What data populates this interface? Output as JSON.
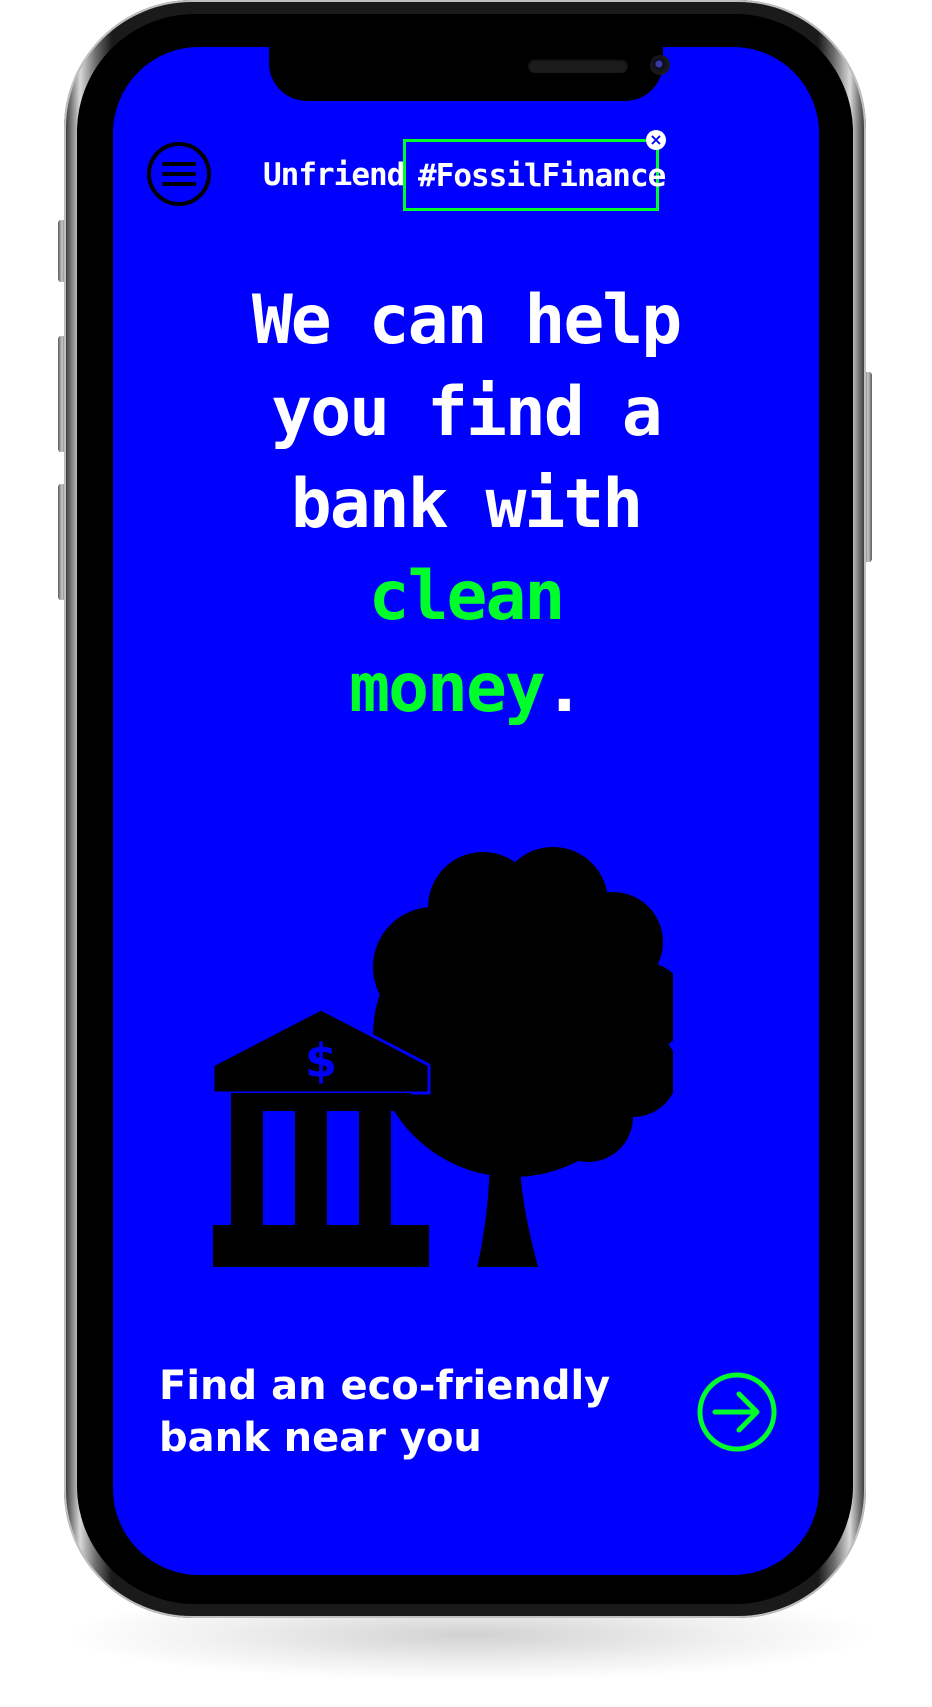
{
  "header": {
    "brand_prefix": "Unfriend",
    "hashtag": "#FossilFinance",
    "close_symbol": "×",
    "menu_icon": "hamburger-menu-icon"
  },
  "hero": {
    "line1": "We can help",
    "line2": "you find a",
    "line3": "bank with",
    "accent1": "clean",
    "accent2": "money",
    "punctuation": "."
  },
  "illustration": {
    "icons": [
      "bank-icon",
      "dollar-sign-icon",
      "tree-icon"
    ],
    "dollar_symbol": "$"
  },
  "cta": {
    "line1": "Find an eco-friendly",
    "line2": "bank near you",
    "icon": "arrow-right-icon"
  },
  "colors": {
    "background": "#0000ff",
    "accent": "#00ff2a",
    "text": "#ffffff",
    "ink": "#000000"
  }
}
